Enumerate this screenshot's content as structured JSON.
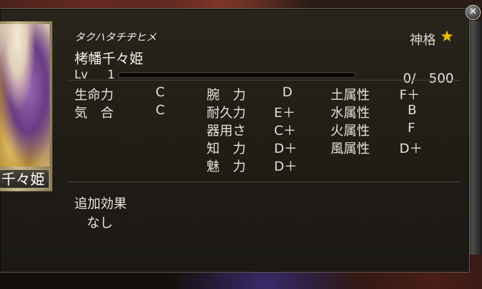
{
  "character": {
    "reading": "タクハタチヂヒメ",
    "name": "栲幡千々姫",
    "card_name": "千々姫",
    "rank": "神格",
    "level_label": "Lv",
    "level": "1",
    "exp_text": "0/　500",
    "exp_fraction": 0.0
  },
  "stats_left": [
    {
      "label": "生命力",
      "value": "C"
    },
    {
      "label": "気　合",
      "value": "C"
    }
  ],
  "stats_mid": [
    {
      "label": "腕　力",
      "value": "D"
    },
    {
      "label": "耐久力",
      "value": "E＋"
    },
    {
      "label": "器用さ",
      "value": "C＋"
    },
    {
      "label": "知　力",
      "value": "D＋"
    },
    {
      "label": "魅　力",
      "value": "D＋"
    }
  ],
  "stats_right": [
    {
      "label": "土属性",
      "value": "F＋"
    },
    {
      "label": "水属性",
      "value": "B"
    },
    {
      "label": "火属性",
      "value": "F"
    },
    {
      "label": "風属性",
      "value": "D＋"
    }
  ],
  "extra": {
    "title": "追加効果",
    "value": "なし"
  },
  "icons": {
    "rank": "star-icon",
    "close": "close-icon"
  },
  "colors": {
    "star": "#f0c000",
    "panel": "#1f1c16",
    "text": "#e9e6dc"
  }
}
